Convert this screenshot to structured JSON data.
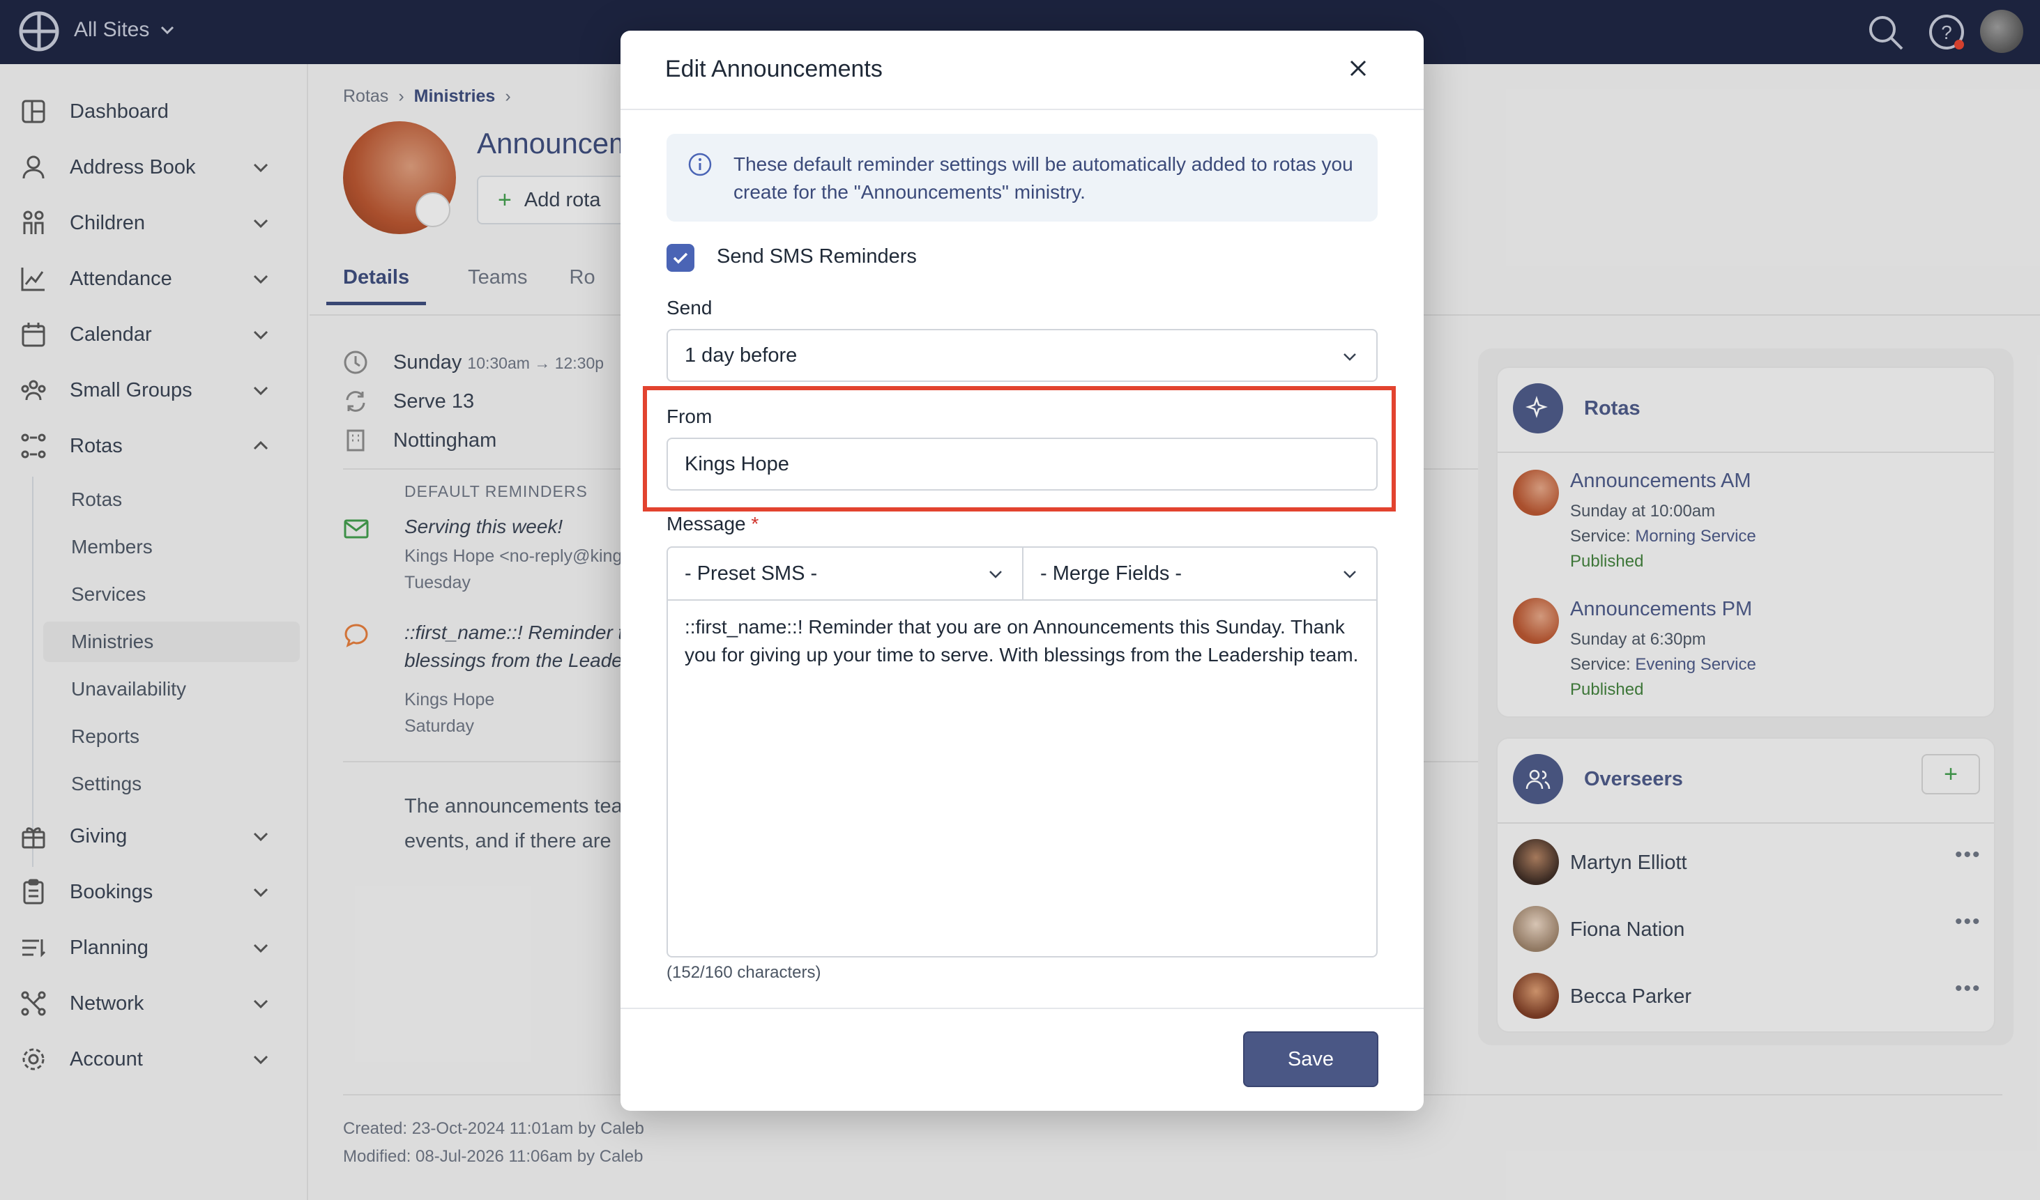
{
  "topbar": {
    "site_selector": "All Sites"
  },
  "sidebar": {
    "items": [
      {
        "label": "Dashboard"
      },
      {
        "label": "Address Book"
      },
      {
        "label": "Children"
      },
      {
        "label": "Attendance"
      },
      {
        "label": "Calendar"
      },
      {
        "label": "Small Groups"
      },
      {
        "label": "Rotas"
      },
      {
        "label": "Giving"
      },
      {
        "label": "Bookings"
      },
      {
        "label": "Planning"
      },
      {
        "label": "Network"
      },
      {
        "label": "Account"
      }
    ],
    "rotas_sub": [
      "Rotas",
      "Members",
      "Services",
      "Ministries",
      "Unavailability",
      "Reports",
      "Settings"
    ]
  },
  "page": {
    "breadcrumb": [
      "Rotas",
      "Ministries"
    ],
    "title": "Announcem",
    "add_rota": "Add rota",
    "tabs": [
      "Details",
      "Teams",
      "Ro"
    ],
    "schedule_day": "Sunday",
    "schedule_time": "10:30am → 12:30p",
    "serve": "Serve 13",
    "location": "Nottingham",
    "default_reminders_label": "DEFAULT REMINDERS",
    "reminder1": {
      "title": "Serving this week!",
      "from": "Kings Hope  <no-reply@king",
      "when": "Tuesday"
    },
    "reminder2": {
      "title_line1": "::first_name::! Reminder t",
      "title_line2": "blessings from the Leader",
      "from": "Kings Hope",
      "when": "Saturday"
    },
    "desc_line1": "The announcements tea",
    "desc_line2": "events, and if there are",
    "created": "Created: 23-Oct-2024 11:01am by Caleb",
    "modified": "Modified: 08-Jul-2026 11:06am by Caleb"
  },
  "rotas_card": {
    "title": "Rotas",
    "items": [
      {
        "name": "Announcements AM",
        "time": "Sunday at 10:00am",
        "service_prefix": "Service: ",
        "service": "Morning Service",
        "status": "Published"
      },
      {
        "name": "Announcements PM",
        "time": "Sunday at 6:30pm",
        "service_prefix": "Service: ",
        "service": "Evening Service",
        "status": "Published"
      }
    ]
  },
  "overseers_card": {
    "title": "Overseers",
    "people": [
      "Martyn Elliott",
      "Fiona Nation",
      "Becca Parker"
    ]
  },
  "modal": {
    "title": "Edit Announcements",
    "info": "These default reminder settings will be automatically added to rotas you create for the \"Announcements\" ministry.",
    "send_sms_label": "Send SMS Reminders",
    "send_sms_checked": true,
    "send_label": "Send",
    "send_value": "1 day before",
    "from_label": "From",
    "from_value": "Kings Hope",
    "message_label": "Message",
    "required_mark": "*",
    "preset_sms": "- Preset SMS -",
    "merge_fields": "- Merge Fields -",
    "message": "::first_name::! Reminder that you are on Announcements this Sunday. Thank you for giving up your time to serve. With blessings from the Leadership team.",
    "char_count": "(152/160 characters)",
    "save_label": "Save"
  },
  "colors": {
    "topbar": "#1c2340",
    "accent": "#4a5785",
    "highlight": "#e2432f",
    "checkbox": "#4a64b5"
  }
}
